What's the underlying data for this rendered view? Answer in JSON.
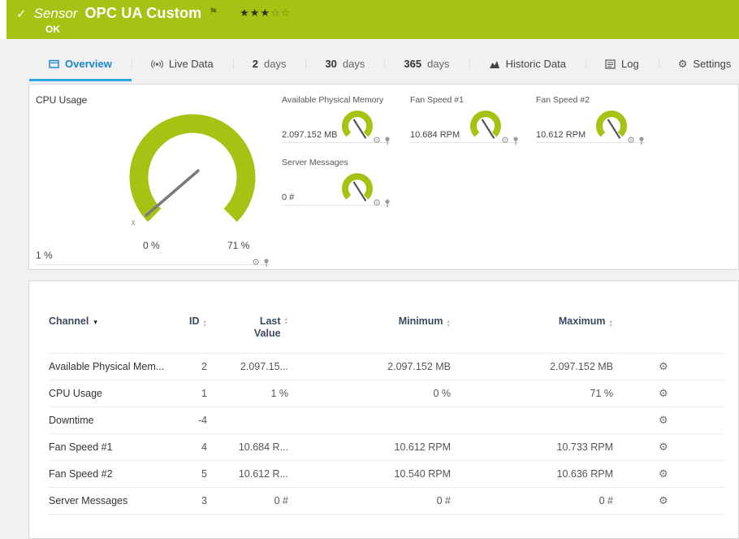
{
  "colors": {
    "brand_green": "#a6c313",
    "tab_active_blue": "#1787c9",
    "tab_underline_blue": "#2aa7e0"
  },
  "icons": {
    "check": "✓",
    "flag": "⚑",
    "gear": "⚙",
    "caret_down": "▾",
    "sort_up": "▲",
    "sort_down": "▼"
  },
  "header": {
    "kind": "Sensor",
    "title": "OPC UA Custom",
    "status": "OK",
    "stars_filled": "★★★",
    "stars_empty": "☆☆",
    "rating": "3 of 5"
  },
  "tabs": [
    {
      "label": "Overview"
    },
    {
      "label": "Live Data"
    },
    {
      "num": "2",
      "unit": "days"
    },
    {
      "num": "30",
      "unit": "days"
    },
    {
      "num": "365",
      "unit": "days"
    },
    {
      "label": "Historic Data"
    },
    {
      "label": "Log"
    },
    {
      "label": "Settings"
    }
  ],
  "gauges": {
    "cpu": {
      "title": "CPU Usage",
      "value": "1 %",
      "scale_min": "0 %",
      "scale_max": "71 %",
      "avg_marker": "x̄"
    },
    "small": [
      {
        "title": "Available Physical Memory",
        "value": "2.097.152 MB"
      },
      {
        "title": "Fan Speed #1",
        "value": "10.684 RPM"
      },
      {
        "title": "Fan Speed #2",
        "value": "10.612 RPM"
      },
      {
        "title": "Server Messages",
        "value": "0 #"
      }
    ]
  },
  "table": {
    "headers": {
      "channel": "Channel",
      "id": "ID",
      "last_value": "Last Value",
      "minimum": "Minimum",
      "maximum": "Maximum"
    },
    "rows": [
      {
        "channel": "Available Physical Mem...",
        "id": "2",
        "last": "2.097.15...",
        "min": "2.097.152 MB",
        "max": "2.097.152 MB"
      },
      {
        "channel": "CPU Usage",
        "id": "1",
        "last": "1 %",
        "min": "0 %",
        "max": "71 %"
      },
      {
        "channel": "Downtime",
        "id": "-4",
        "last": "",
        "min": "",
        "max": ""
      },
      {
        "channel": "Fan Speed #1",
        "id": "4",
        "last": "10.684 R...",
        "min": "10.612 RPM",
        "max": "10.733 RPM"
      },
      {
        "channel": "Fan Speed #2",
        "id": "5",
        "last": "10.612 R...",
        "min": "10.540 RPM",
        "max": "10.636 RPM"
      },
      {
        "channel": "Server Messages",
        "id": "3",
        "last": "0 #",
        "min": "0 #",
        "max": "0 #"
      }
    ]
  }
}
